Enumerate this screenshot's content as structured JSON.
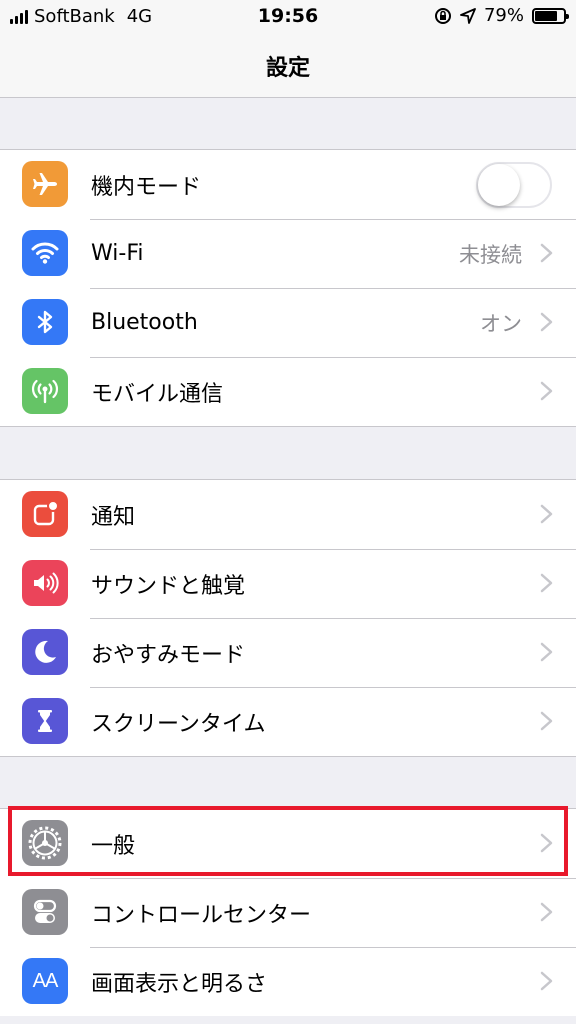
{
  "status_bar": {
    "carrier": "SoftBank",
    "network": "4G",
    "time": "19:56",
    "battery_percent": "79%",
    "battery_level": 0.79
  },
  "nav": {
    "title": "設定"
  },
  "groups": [
    {
      "rows": [
        {
          "label": "機内モード",
          "icon": "airplane-icon",
          "icon_color": "#f19a37",
          "control": "toggle",
          "toggle_on": false
        },
        {
          "label": "Wi-Fi",
          "value": "未接続",
          "icon": "wifi-icon",
          "icon_color": "#3478f6"
        },
        {
          "label": "Bluetooth",
          "value": "オン",
          "icon": "bluetooth-icon",
          "icon_color": "#3478f6"
        },
        {
          "label": "モバイル通信",
          "icon": "antenna-icon",
          "icon_color": "#65c466"
        }
      ]
    },
    {
      "rows": [
        {
          "label": "通知",
          "icon": "notification-icon",
          "icon_color": "#eb4d3d"
        },
        {
          "label": "サウンドと触覚",
          "icon": "speaker-icon",
          "icon_color": "#eb445a"
        },
        {
          "label": "おやすみモード",
          "icon": "moon-icon",
          "icon_color": "#5856d6"
        },
        {
          "label": "スクリーンタイム",
          "icon": "hourglass-icon",
          "icon_color": "#5856d6"
        }
      ]
    },
    {
      "rows": [
        {
          "label": "一般",
          "icon": "gear-icon",
          "icon_color": "#8e8e93"
        },
        {
          "label": "コントロールセンター",
          "icon": "switches-icon",
          "icon_color": "#8e8e93"
        },
        {
          "label": "画面表示と明るさ",
          "icon": "text-size-icon",
          "icon_color": "#3478f6",
          "icon_text": "AA"
        }
      ]
    }
  ],
  "highlight_color": "#e8192c"
}
